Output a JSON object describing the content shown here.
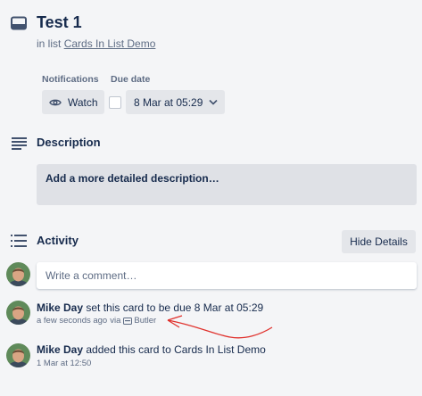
{
  "card": {
    "title": "Test 1",
    "in_list_prefix": "in list",
    "list_name": "Cards In List Demo"
  },
  "notifications": {
    "label": "Notifications",
    "watch_label": "Watch"
  },
  "due_date": {
    "label": "Due date",
    "value": "8 Mar at 05:29",
    "completed": false
  },
  "description": {
    "title": "Description",
    "placeholder": "Add a more detailed description…"
  },
  "activity": {
    "title": "Activity",
    "hide_details_label": "Hide Details",
    "comment_placeholder": "Write a comment…",
    "entries": [
      {
        "author": "Mike Day",
        "action": "set this card to be due 8 Mar at 05:29",
        "timestamp": "a few seconds ago",
        "via_prefix": "via",
        "via_name": "Butler"
      },
      {
        "author": "Mike Day",
        "action": "added this card to Cards In List Demo",
        "timestamp": "1 Mar at 12:50"
      }
    ]
  },
  "icons": {
    "card": "card-icon",
    "watch": "eye-icon",
    "chevron": "chevron-down-icon",
    "description": "text-lines-icon",
    "activity": "list-icon",
    "butler": "butler-icon",
    "annotation": "red-arrow-annotation"
  },
  "colors": {
    "background": "#f4f5f7",
    "button": "#e4e6ea",
    "text": "#172b4d",
    "subtle_text": "#5e6c84",
    "annotation": "#e0312c"
  }
}
